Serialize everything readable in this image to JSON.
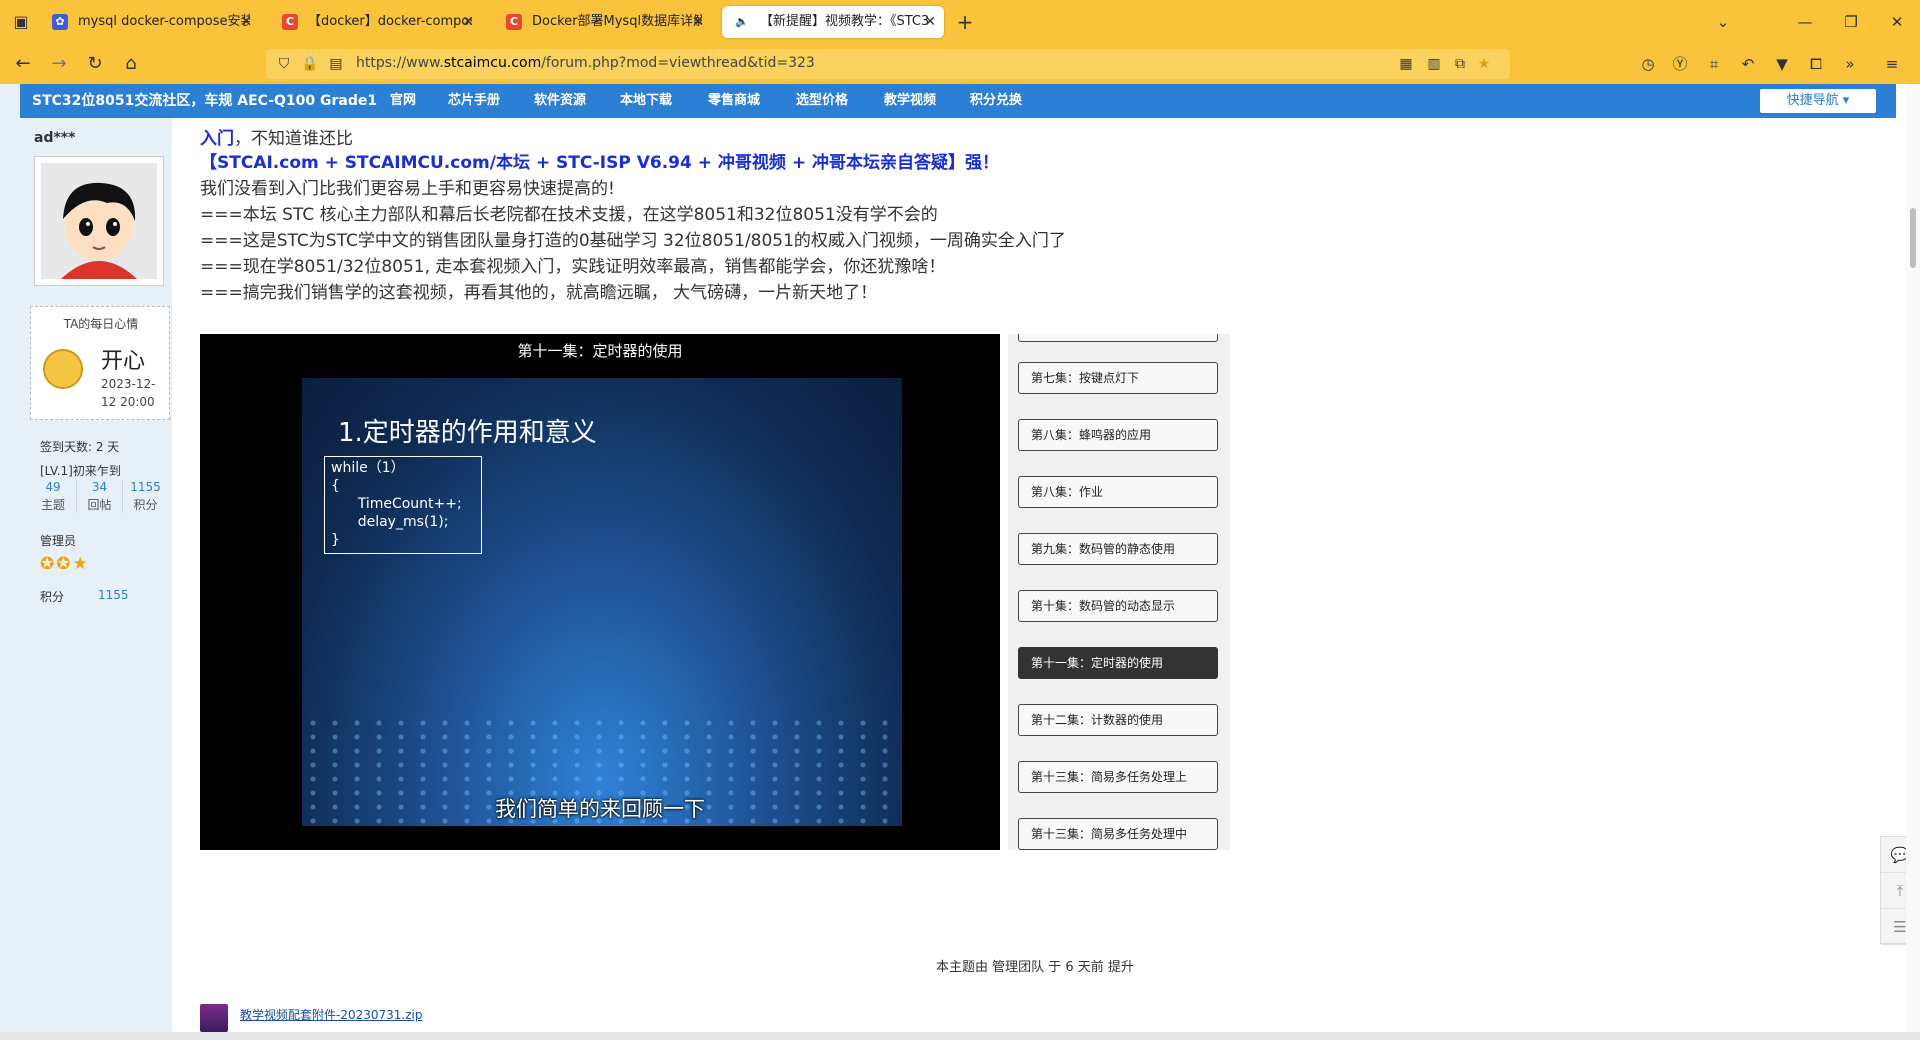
{
  "browser": {
    "tabs": [
      {
        "title": "mysql docker-compose安装_",
        "icon": "baidu-paw-icon",
        "color": "#3b5bdb"
      },
      {
        "title": "【docker】docker-compose部",
        "icon": "csdn-c-icon",
        "color": "#e8472d"
      },
      {
        "title": "Docker部署Mysql数据库详解-",
        "icon": "csdn-c-icon",
        "color": "#e8472d"
      },
      {
        "title": "【新提醒】视频教学：《STC3",
        "icon": "speaker-icon",
        "color": "#333333"
      }
    ],
    "close_glyph": "✕",
    "new_tab_glyph": "+",
    "url_scheme_host": "https://www.",
    "url_domain": "stcaimcu.com",
    "url_path": "/forum.php?mod=viewthread&tid=323"
  },
  "site": {
    "brand": "STC32位8051交流社区，车规 AEC-Q100 Grade1",
    "nav": [
      "官网",
      "芯片手册",
      "软件资源",
      "本地下载",
      "零售商城",
      "选型价格",
      "教学视频",
      "积分兑换"
    ],
    "quick_nav": "快捷导航 ▾"
  },
  "user": {
    "name": "ad***",
    "mood_title": "TA的每日心情",
    "mood": "开心",
    "mood_date": "2023-12-12 20:00",
    "signin": "签到天数: 2 天",
    "level": "[LV.1]初来乍到",
    "stats": [
      {
        "value": "49",
        "label": "主题"
      },
      {
        "value": "34",
        "label": "回帖"
      },
      {
        "value": "1155",
        "label": "积分"
      }
    ],
    "role": "管理员",
    "points_label": "积分",
    "points_value": "1155"
  },
  "post": {
    "line1_bold": "入门",
    "line1_rest": "，不知道谁还比",
    "line2": "【STCAI.com + STCAIMCU.com/本坛 + STC-ISP V6.94 + 冲哥视频 + 冲哥本坛亲自答疑】强！",
    "line3": "我们没看到入门比我们更容易上手和更容易快速提高的!",
    "line4": "===本坛 STC  核心主力部队和幕后长老院都在技术支援，在这学8051和32位8051没有学不会的",
    "line5": "===这是STC为STC学中文的销售团队量身打造的0基础学习 32位8051/8051的权威入门视频，一周确实全入门了",
    "line6": "===现在学8051/32位8051, 走本套视频入门，实践证明效率最高，销售都能学会，你还犹豫啥！",
    "line7": "===搞完我们销售学的这套视频，再看其他的，就高瞻远瞩， 大气磅礴，一片新天地了！"
  },
  "player": {
    "title": "第十一集：定时器的使用",
    "slide_title": "1.定时器的作用和意义",
    "code": "while（1）\n{\n      TimeCount++;\n      delay_ms(1);\n}",
    "subtitle": "我们简单的来回顾一下"
  },
  "playlist": [
    {
      "label": "第七集：按键点灯下",
      "active": false
    },
    {
      "label": "第八集：蜂鸣器的应用",
      "active": false
    },
    {
      "label": "第八集：作业",
      "active": false
    },
    {
      "label": "第九集：数码管的静态使用",
      "active": false
    },
    {
      "label": "第十集：数码管的动态显示",
      "active": false
    },
    {
      "label": "第十一集：定时器的使用",
      "active": true
    },
    {
      "label": "第十二集：计数器的使用",
      "active": false
    },
    {
      "label": "第十三集：简易多任务处理上",
      "active": false
    },
    {
      "label": "第十三集：简易多任务处理中",
      "active": false
    }
  ],
  "notice": "本主题由 管理团队 于 6 天前 提升",
  "attachment": {
    "name": "教学视频配套附件-20230731.zip"
  },
  "colors": {
    "chrome": "#f9c33b",
    "site_blue": "#2b7fd4",
    "post_blue": "#1a2fd0"
  }
}
